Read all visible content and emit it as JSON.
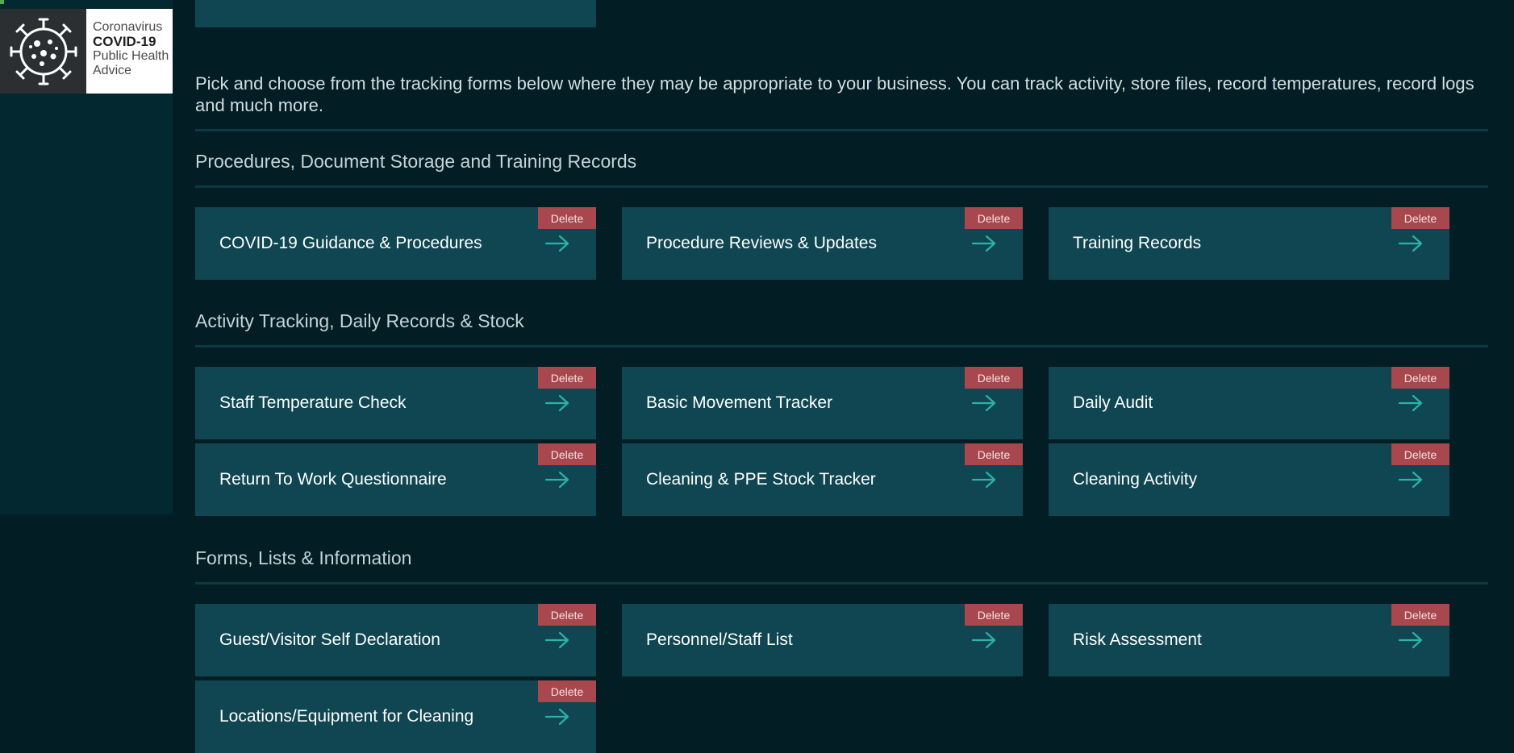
{
  "logo": {
    "line1": "Coronavirus",
    "line2": "COVID-19",
    "line3": "Public Health",
    "line4": "Advice",
    "icon": "virus-icon"
  },
  "intro": "Pick and choose from the tracking forms below where they may be appropriate to your business. You can track activity, store files, record temperatures, record logs and much more.",
  "delete_label": "Delete",
  "arrow_icon": "arrow-right-icon",
  "colors": {
    "background": "#021d24",
    "card": "#0f4651",
    "delete": "#a8474d",
    "arrow": "#2bb3a8"
  },
  "sections": [
    {
      "title": "Procedures, Document Storage and Training Records",
      "cards": [
        "COVID-19 Guidance & Procedures",
        "Procedure Reviews & Updates",
        "Training Records"
      ]
    },
    {
      "title": "Activity Tracking, Daily Records & Stock",
      "cards": [
        "Staff Temperature Check",
        "Basic Movement Tracker",
        "Daily Audit",
        "Return To Work Questionnaire",
        "Cleaning & PPE Stock Tracker",
        "Cleaning Activity"
      ]
    },
    {
      "title": "Forms, Lists & Information",
      "cards": [
        "Guest/Visitor Self Declaration",
        "Personnel/Staff List",
        "Risk Assessment",
        "Locations/Equipment for Cleaning"
      ]
    }
  ]
}
